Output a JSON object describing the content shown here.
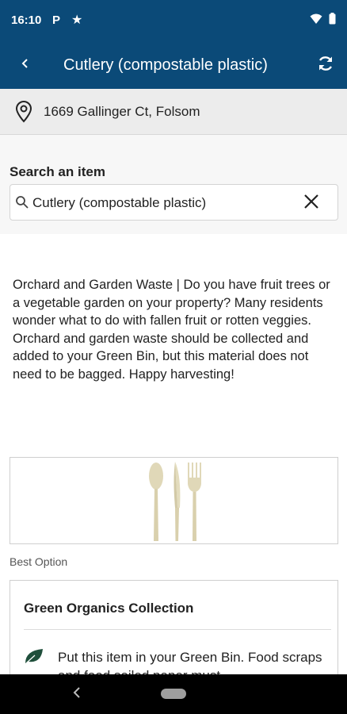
{
  "status_bar": {
    "time": "16:10",
    "p_label": "P"
  },
  "header": {
    "title": "Cutlery (compostable plastic)"
  },
  "address": {
    "text": "1669 Gallinger Ct, Folsom"
  },
  "search": {
    "label": "Search an item",
    "value": "Cutlery (compostable plastic)"
  },
  "info": {
    "text": "Orchard and Garden Waste | Do you have fruit trees or a vegetable garden on your property? Many residents wonder what to do with fallen fruit or rotten veggies. Orchard and garden waste should be collected and added to your Green Bin, but this material does not need to be bagged. Happy harvesting!"
  },
  "best_option": {
    "label": "Best Option"
  },
  "option_card": {
    "title": "Green Organics Collection",
    "body": "Put this item in your Green Bin. Food scraps and food soiled paper must"
  },
  "colors": {
    "header_bg": "#0b4a78",
    "leaf": "#1f4f3b"
  },
  "icons": [
    "star-icon",
    "wifi-icon",
    "battery-icon",
    "back-arrow-icon",
    "refresh-icon",
    "location-pin-icon",
    "search-icon",
    "close-icon",
    "cutlery-image",
    "leaf-icon",
    "nav-back-icon",
    "nav-home-pill"
  ]
}
